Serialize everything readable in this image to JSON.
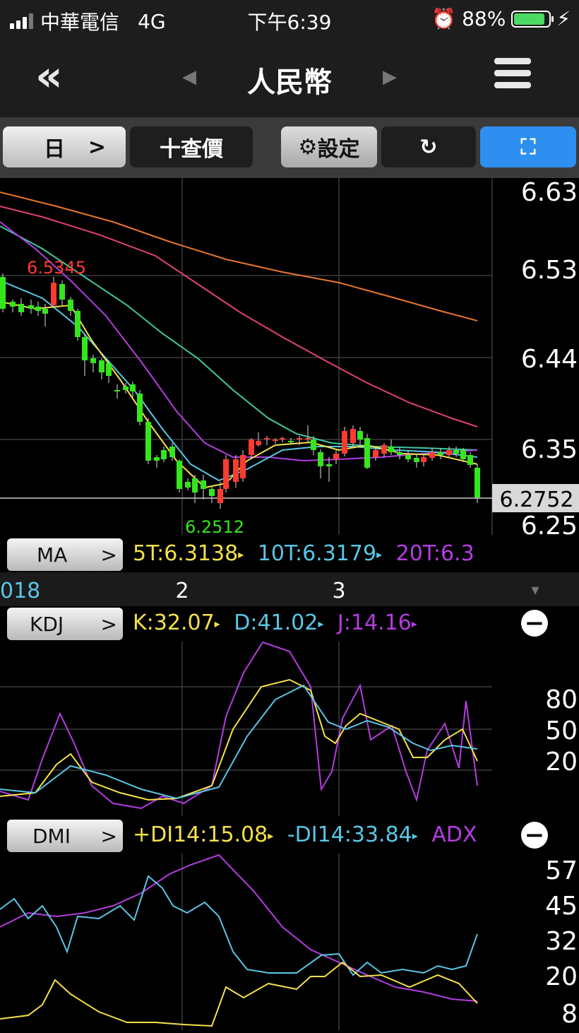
{
  "status": {
    "carrier": "中華電信",
    "network": "4G",
    "time": "下午6:39",
    "battery": "88%",
    "battery_level": 0.88
  },
  "nav": {
    "back": "«",
    "title": "人民幣",
    "prev": "◀",
    "next": "▶"
  },
  "toolbar": {
    "period": "日",
    "period_arrow": ">",
    "crosshair": "十查價",
    "settings": "設定",
    "rotate": "↻",
    "fullscreen": "⛶"
  },
  "main": {
    "price_ticks": [
      "6.63",
      "6.53",
      "6.44",
      "6.35",
      "6.25"
    ],
    "current_price": "6.2752",
    "high_label": "6.5345",
    "low_label": "6.2512"
  },
  "ma": {
    "label": "MA",
    "ma5": "5T:6.3138",
    "ma10": "10T:6.3179",
    "ma20": "20T:6.3"
  },
  "axis": {
    "year": "018",
    "m2": "2",
    "m3": "3"
  },
  "kdj": {
    "label": "KDJ",
    "k": "K:32.07",
    "d": "D:41.02",
    "j": "J:14.16",
    "ticks": [
      "80",
      "50",
      "20"
    ]
  },
  "dmi": {
    "label": "DMI",
    "pdi": "+DI14:15.08",
    "mdi": "-DI14:33.84",
    "adx": "ADX",
    "ticks": [
      "57",
      "45",
      "32",
      "20",
      "8"
    ]
  },
  "colors": {
    "up": "#ff3b30",
    "down": "#35e61c",
    "yellow": "#f5e14a",
    "cyan": "#59c6e6",
    "purple": "#b43ce0",
    "orange": "#e8752c",
    "pink": "#e0407a",
    "teal": "#3fc6a4",
    "active": "#2e8ff0"
  },
  "chart_data": {
    "type": "candlestick",
    "price_axis": {
      "ticks": [
        6.63,
        6.53,
        6.44,
        6.35,
        6.25
      ],
      "current": 6.2752,
      "high": 6.5345,
      "low": 6.2512
    },
    "kdj": {
      "K": 32.07,
      "D": 41.02,
      "J": 14.16,
      "ticks": [
        80,
        50,
        20
      ]
    },
    "dmi": {
      "+DI14": 15.08,
      "-DI14": 33.84,
      "ticks": [
        57,
        45,
        32,
        20,
        8
      ]
    },
    "ma": {
      "5T": 6.3138,
      "10T": 6.3179
    }
  }
}
